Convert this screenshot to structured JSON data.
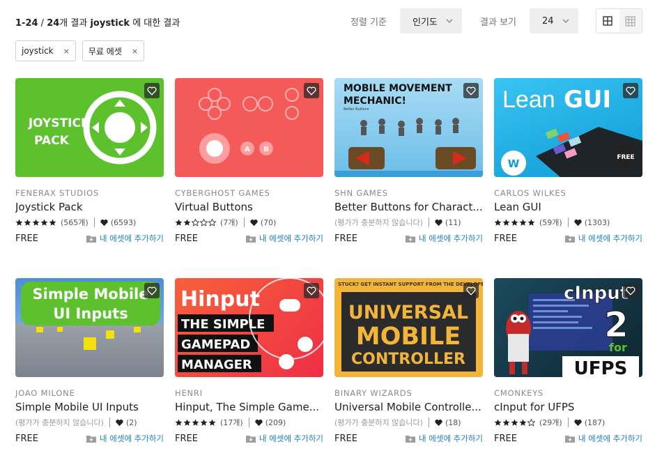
{
  "header": {
    "range": "1-24",
    "separator": " / ",
    "total": "24",
    "count_suffix": "개 결과",
    "query": "joystick",
    "tail": " 에 대한 결과",
    "sort_label": "정렬 기준",
    "sort_value": "인기도",
    "view_label": "결과 보기",
    "view_value": "24"
  },
  "filters": [
    {
      "label": "joystick",
      "remove": "×"
    },
    {
      "label": "무료 에셋",
      "remove": "×"
    }
  ],
  "add_label": "내 에셋에 추가하기",
  "cards": [
    {
      "publisher": "FENERAX STUDIOS",
      "title": "Joystick Pack",
      "rating": 5,
      "rating_count": "(565개)",
      "likes": "(6593)",
      "price": "FREE",
      "no_rating_text": ""
    },
    {
      "publisher": "CYBERGHOST GAMES",
      "title": "Virtual Buttons",
      "rating": 2,
      "rating_count": "(7개)",
      "likes": "(70)",
      "price": "FREE",
      "no_rating_text": ""
    },
    {
      "publisher": "SHN GAMES",
      "title": "Better Buttons for Charact...",
      "rating": 0,
      "rating_count": "",
      "likes": "(11)",
      "price": "FREE",
      "no_rating_text": "(평가가 충분하지 않습니다)"
    },
    {
      "publisher": "CARLOS WILKES",
      "title": "Lean GUI",
      "rating": 5,
      "rating_count": "(59개)",
      "likes": "(1303)",
      "price": "FREE",
      "no_rating_text": ""
    },
    {
      "publisher": "JOAO MILONE",
      "title": "Simple Mobile UI Inputs",
      "rating": 0,
      "rating_count": "",
      "likes": "(2)",
      "price": "FREE",
      "no_rating_text": "(평가가 충분하지 않습니다)"
    },
    {
      "publisher": "HENRI",
      "title": "Hinput, The Simple Game...",
      "rating": 5,
      "rating_count": "(17개)",
      "likes": "(209)",
      "price": "FREE",
      "no_rating_text": ""
    },
    {
      "publisher": "BINARY WIZARDS",
      "title": "Universal Mobile Controlle...",
      "rating": 0,
      "rating_count": "",
      "likes": "(18)",
      "price": "FREE",
      "no_rating_text": "(평가가 충분하지 않습니다)"
    },
    {
      "publisher": "CMONKEYS",
      "title": "cInput for UFPS",
      "rating": 4,
      "rating_count": "(29개)",
      "likes": "(187)",
      "price": "FREE",
      "no_rating_text": ""
    }
  ],
  "thumb_text": {
    "joystick": [
      "JOYSTICK",
      "PACK"
    ],
    "virtual": [
      "A",
      "B"
    ],
    "better": [
      "MOBILE MOVEMENT",
      "MECHANIC!",
      "Better Buttons"
    ],
    "lean": [
      "Lean",
      "GUI",
      "FREE"
    ],
    "simple": [
      "Simple Mobile",
      "UI Inputs"
    ],
    "hinput": [
      "Hinput",
      "THE SIMPLE",
      "GAMEPAD",
      "MANAGER"
    ],
    "universal": [
      "STUCK? GET INSTANT SUPPORT FROM THE DEVELOPER",
      "UNIVERSAL",
      "MOBILE",
      "CONTROLLER"
    ],
    "cinput": [
      "cInput",
      "2",
      "for",
      "UFPS"
    ]
  },
  "colors": {
    "accent_link": "#1d82c7",
    "joystick_bg": "#5cc12d",
    "virtual_bg": "#f55a5a",
    "better_bg": "#7fc8ef",
    "lean_bg": "#19b0e8",
    "simple_sky": "#4a8fd6",
    "hinput_bg": "#f2543a",
    "universal_bg": "#f2b53a",
    "cinput_bg": "#1b3a4a"
  },
  "icons": [
    "heart-icon",
    "star-icon",
    "folder-plus-icon",
    "chevron-down-icon",
    "grid-large-icon",
    "grid-small-icon",
    "close-icon"
  ]
}
